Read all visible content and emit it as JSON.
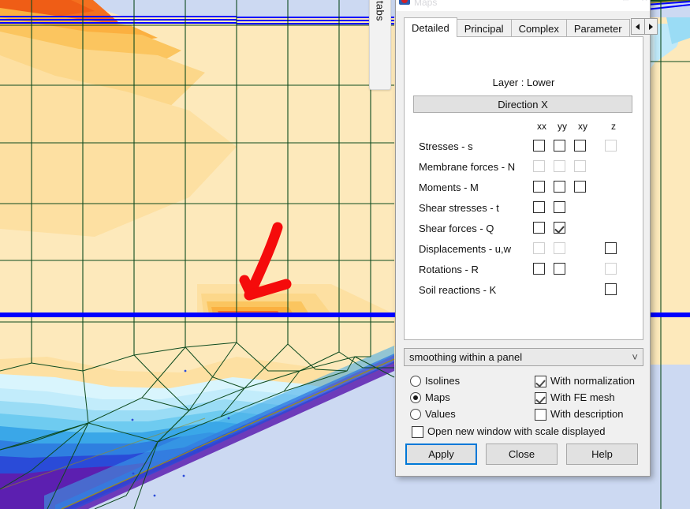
{
  "tooltip": {
    "label": "tabs"
  },
  "dialog": {
    "title": "Maps",
    "icon": "maps-icon",
    "window_buttons": [
      "minimize",
      "maximize",
      "close"
    ],
    "tabs": [
      {
        "label": "Detailed",
        "active": true
      },
      {
        "label": "Principal",
        "active": false
      },
      {
        "label": "Complex",
        "active": false
      },
      {
        "label": "Parameter",
        "active": false
      }
    ],
    "tab_nav": {
      "prev": "left-arrow",
      "next": "right-arrow"
    },
    "layer_label": "Layer : Lower",
    "direction_button": "Direction X",
    "column_headers": [
      "xx",
      "yy",
      "xy",
      "z"
    ],
    "rows": [
      {
        "label": "Stresses - s",
        "xx": "enabled",
        "yy": "enabled",
        "xy": "enabled",
        "z": "disabled"
      },
      {
        "label": "Membrane forces - N",
        "xx": "disabled",
        "yy": "disabled",
        "xy": "disabled",
        "z": "none"
      },
      {
        "label": "Moments - M",
        "xx": "enabled",
        "yy": "enabled",
        "xy": "enabled",
        "z": "none"
      },
      {
        "label": "Shear stresses - t",
        "xx": "enabled",
        "yy": "enabled",
        "xy": "none",
        "z": "none"
      },
      {
        "label": "Shear forces - Q",
        "xx": "enabled",
        "yy": "checked",
        "xy": "none",
        "z": "none"
      },
      {
        "label": "Displacements - u,w",
        "xx": "disabled",
        "yy": "disabled",
        "xy": "none",
        "z": "enabled"
      },
      {
        "label": "Rotations - R",
        "xx": "enabled",
        "yy": "enabled",
        "xy": "none",
        "z": "disabled"
      },
      {
        "label": "Soil reactions - K",
        "xx": "none",
        "yy": "none",
        "xy": "none",
        "z": "enabled"
      }
    ],
    "smoothing_combo": {
      "value": "smoothing within a panel",
      "chevron": "chevron-down-icon"
    },
    "display_mode": {
      "options": [
        "Isolines",
        "Maps",
        "Values"
      ],
      "selected": "Maps"
    },
    "checkboxes": [
      {
        "label": "With normalization",
        "checked": true
      },
      {
        "label": "With FE mesh",
        "checked": true
      },
      {
        "label": "With description",
        "checked": false
      }
    ],
    "open_new_window": {
      "label": "Open new window with scale displayed",
      "checked": false
    },
    "buttons": [
      {
        "label": "Apply",
        "default": true
      },
      {
        "label": "Close",
        "default": false
      },
      {
        "label": "Help",
        "default": false
      }
    ]
  },
  "plot": {
    "description": "finite-element contour map of shear forces",
    "annotation": "red-arrow",
    "colors": {
      "deep_orange": "#f4701f",
      "orange": "#fbb040",
      "light_orange": "#fcd78a",
      "pale_yellow": "#fde9bb",
      "pale_cyan": "#d9f5fd",
      "light_blue": "#9adcf5",
      "blue": "#3aa7e8",
      "deep_blue": "#2a4bd8",
      "violet": "#5c1fb0",
      "lavender": "#ccd9f2",
      "mesh_green": "#0d4a1e",
      "marker_blue": "#0000ff",
      "annotation_red": "#f50b0b"
    }
  }
}
